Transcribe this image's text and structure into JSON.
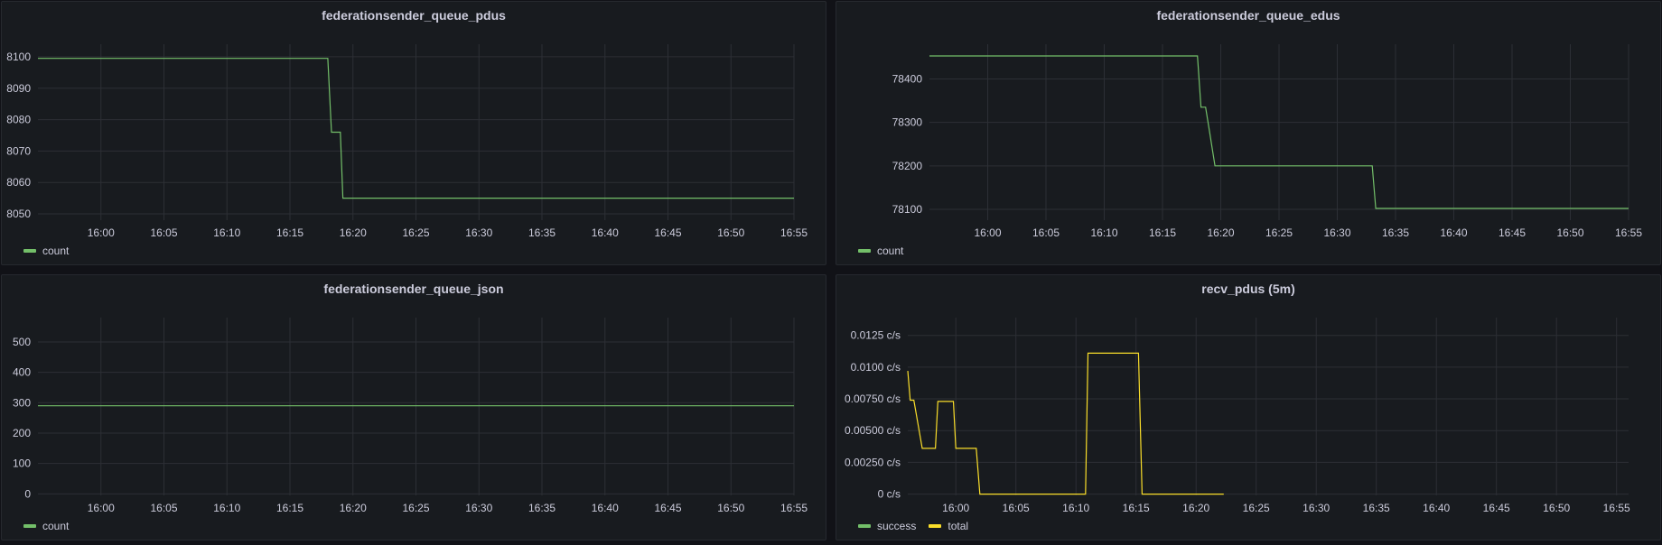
{
  "chart_data": [
    {
      "type": "line",
      "title": "federationsender_queue_pdus",
      "x_ticks": [
        "16:00",
        "16:05",
        "16:10",
        "16:15",
        "16:20",
        "16:25",
        "16:30",
        "16:35",
        "16:40",
        "16:45",
        "16:50",
        "16:55"
      ],
      "x_range": [
        "15:55",
        "16:55"
      ],
      "y_ticks": [
        "8050",
        "8060",
        "8070",
        "8080",
        "8090",
        "8100"
      ],
      "ylim": [
        8048,
        8104
      ],
      "grid": true,
      "legend_placement": "bottom-left",
      "series": [
        {
          "name": "count",
          "color": "#73bf69",
          "x": [
            "15:55",
            "16:18",
            "16:18.3",
            "16:19",
            "16:19.2",
            "16:55"
          ],
          "values": [
            8099.5,
            8099.5,
            8076,
            8076,
            8055,
            8055
          ]
        }
      ]
    },
    {
      "type": "line",
      "title": "federationsender_queue_edus",
      "x_ticks": [
        "16:00",
        "16:05",
        "16:10",
        "16:15",
        "16:20",
        "16:25",
        "16:30",
        "16:35",
        "16:40",
        "16:45",
        "16:50",
        "16:55"
      ],
      "x_range": [
        "15:55",
        "16:55"
      ],
      "y_ticks": [
        "78100",
        "78200",
        "78300",
        "78400"
      ],
      "ylim": [
        78075,
        78480
      ],
      "grid": true,
      "legend_placement": "bottom-left",
      "series": [
        {
          "name": "count",
          "color": "#73bf69",
          "x": [
            "15:55",
            "16:18",
            "16:18.3",
            "16:18.7",
            "16:19",
            "16:19.5",
            "16:33",
            "16:33.3",
            "16:55"
          ],
          "values": [
            78453,
            78453,
            78335,
            78335,
            78285,
            78200,
            78200,
            78102,
            78102
          ]
        }
      ]
    },
    {
      "type": "line",
      "title": "federationsender_queue_json",
      "x_ticks": [
        "16:00",
        "16:05",
        "16:10",
        "16:15",
        "16:20",
        "16:25",
        "16:30",
        "16:35",
        "16:40",
        "16:45",
        "16:50",
        "16:55"
      ],
      "x_range": [
        "15:55",
        "16:55"
      ],
      "y_ticks": [
        "0",
        "100",
        "200",
        "300",
        "400",
        "500"
      ],
      "ylim": [
        -5,
        580
      ],
      "grid": true,
      "legend_placement": "bottom-left",
      "series": [
        {
          "name": "count",
          "color": "#73bf69",
          "x": [
            "15:55",
            "16:55"
          ],
          "values": [
            290,
            290
          ]
        }
      ]
    },
    {
      "type": "line",
      "title": "recv_pdus (5m)",
      "x_ticks": [
        "16:00",
        "16:05",
        "16:10",
        "16:15",
        "16:20",
        "16:25",
        "16:30",
        "16:35",
        "16:40",
        "16:45",
        "16:50",
        "16:55"
      ],
      "x_range": [
        "15:56",
        "16:56"
      ],
      "y_ticks": [
        "0 c/s",
        "0.00250 c/s",
        "0.00500 c/s",
        "0.00750 c/s",
        "0.0100 c/s",
        "0.0125 c/s"
      ],
      "ylim": [
        -0.0001,
        0.0139
      ],
      "grid": true,
      "legend_placement": "bottom-left",
      "series": [
        {
          "name": "success",
          "color": "#73bf69",
          "x": [],
          "values": []
        },
        {
          "name": "total",
          "color": "#fade2a",
          "x": [
            "15:56",
            "15:56.2",
            "15:56.5",
            "15:57.2",
            "15:57.5",
            "15:58.3",
            "15:58.5",
            "15:59.8",
            "16:00",
            "16:01.7",
            "16:02",
            "16:10.8",
            "16:11",
            "16:15.2",
            "16:15.5",
            "16:22.3"
          ],
          "values": [
            0.0097,
            0.0074,
            0.0074,
            0.0036,
            0.0036,
            0.0036,
            0.0073,
            0.0073,
            0.0036,
            0.0036,
            0,
            0,
            0.0111,
            0.0111,
            0,
            0
          ]
        }
      ]
    }
  ]
}
